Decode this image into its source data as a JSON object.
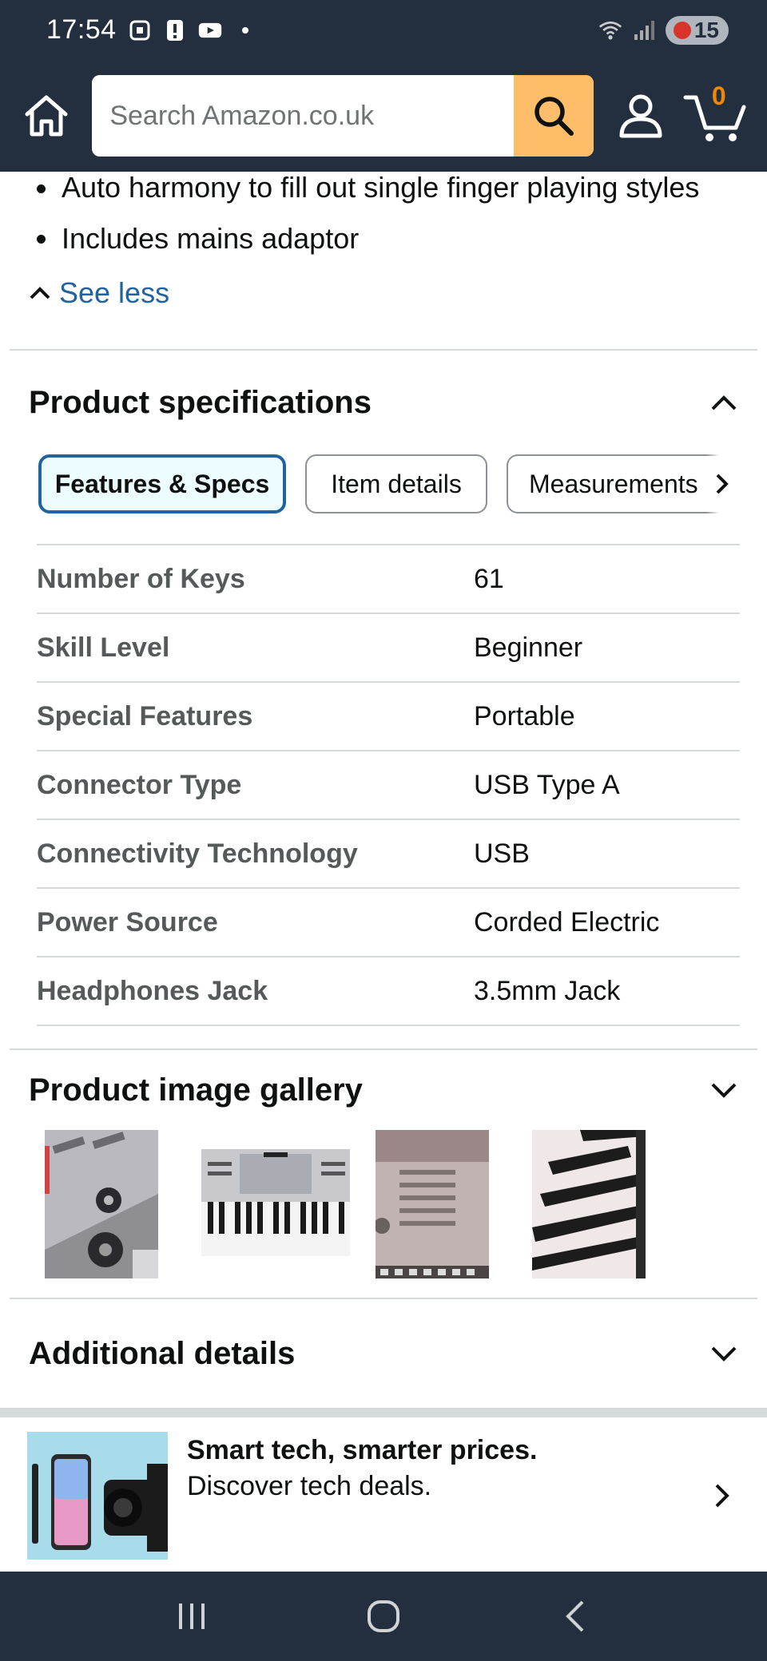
{
  "status_bar": {
    "time": "17:54",
    "battery": "15"
  },
  "header": {
    "search_placeholder": "Search Amazon.co.uk",
    "cart_count": "0"
  },
  "bullets": [
    "Auto harmony to fill out single finger playing styles",
    "Includes mains adaptor"
  ],
  "see_less": "See less",
  "specs": {
    "title": "Product specifications",
    "tabs": [
      {
        "label": "Features & Specs",
        "active": true
      },
      {
        "label": "Item details",
        "active": false
      },
      {
        "label": "Measurements",
        "active": false
      }
    ],
    "rows": [
      {
        "label": "Number of Keys",
        "value": "61"
      },
      {
        "label": "Skill Level",
        "value": "Beginner"
      },
      {
        "label": "Special Features",
        "value": "Portable"
      },
      {
        "label": "Connector Type",
        "value": "USB Type A"
      },
      {
        "label": "Connectivity Technology",
        "value": "USB"
      },
      {
        "label": "Power Source",
        "value": "Corded Electric"
      },
      {
        "label": "Headphones Jack",
        "value": "3.5mm Jack"
      }
    ]
  },
  "gallery": {
    "title": "Product image gallery"
  },
  "additional": {
    "title": "Additional details"
  },
  "promo": {
    "title": "Smart tech, smarter prices.",
    "subtitle": "Discover tech deals."
  },
  "colors": {
    "header_bg": "#232f3e",
    "search_button": "#febd69",
    "link": "#2162a1",
    "cart_count": "#f08804"
  }
}
